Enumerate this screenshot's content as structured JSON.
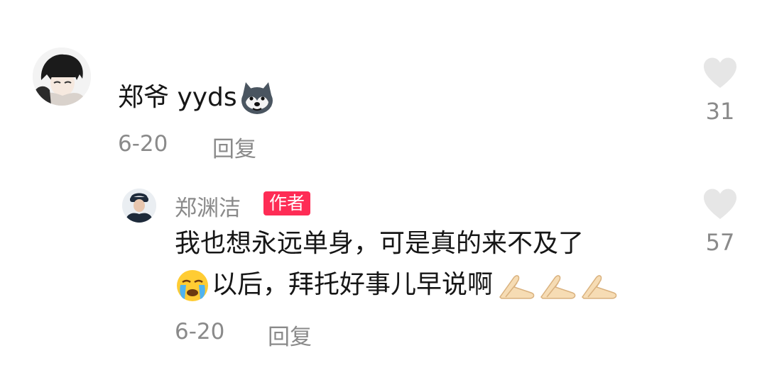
{
  "comment": {
    "text": "郑爷 yyds",
    "emoji": "husky-dog-emoji",
    "date": "6-20",
    "reply_label": "回复",
    "like_count": "31"
  },
  "reply": {
    "username": "郑渊洁",
    "badge": "作者",
    "line1": "我也想永远单身，可是真的来不及了",
    "line2": "以后，拜托好事儿早说啊",
    "leading_emoji": "crying-face-emoji",
    "trailing_emoji": "folded-hands-emoji",
    "date": "6-20",
    "reply_label": "回复",
    "like_count": "57"
  },
  "colors": {
    "text": "#161616",
    "meta": "#8a8a8a",
    "heart": "#e6e6e6",
    "badge": "#fe2c55"
  }
}
